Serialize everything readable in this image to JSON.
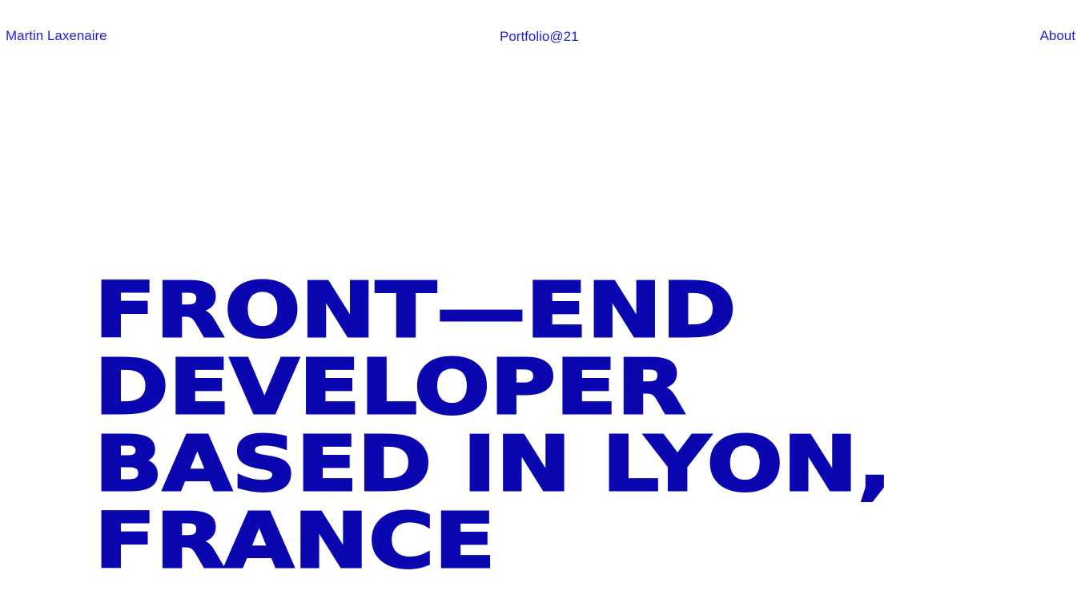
{
  "header": {
    "name": "Martin Laxenaire",
    "portfolio": "Portfolio@21",
    "about": "About"
  },
  "hero": {
    "lines": [
      "FRONT—END",
      "DEVELOPER",
      "BASED IN LYON,",
      "FRANCE"
    ]
  },
  "colors": {
    "accent": "#0a06b0",
    "background": "#ffffff"
  }
}
